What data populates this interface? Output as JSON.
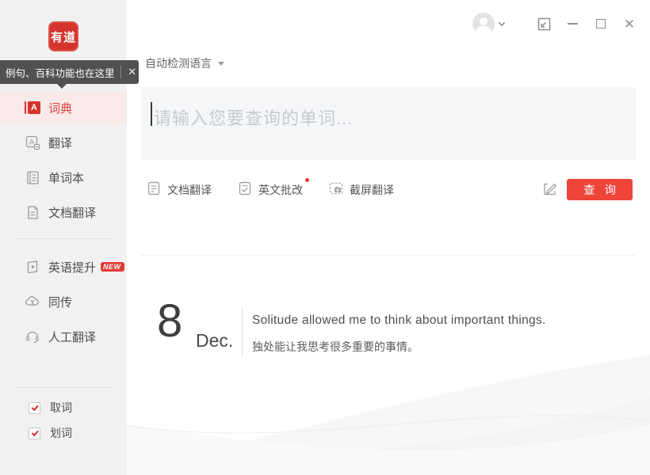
{
  "window": {
    "logo_text": "有道",
    "controls": {
      "close_glyph": "✕"
    }
  },
  "tooltip": {
    "text": "例句、百科功能也在这里",
    "close_glyph": "✕"
  },
  "sidebar": {
    "items": [
      {
        "label": "词典",
        "icon": "dictionary-icon",
        "active": true
      },
      {
        "label": "翻译",
        "icon": "translate-icon"
      },
      {
        "label": "单词本",
        "icon": "wordbook-icon"
      },
      {
        "label": "文档翻译",
        "icon": "document-icon"
      },
      {
        "label": "英语提升",
        "icon": "english-boost-icon",
        "badge": "NEW"
      },
      {
        "label": "同传",
        "icon": "cloud-interpret-icon"
      },
      {
        "label": "人工翻译",
        "icon": "human-translate-icon"
      }
    ],
    "toggles": [
      {
        "label": "取词",
        "checked": true
      },
      {
        "label": "划词",
        "checked": true
      }
    ]
  },
  "topbar": {
    "language_selector": "自动检测语言"
  },
  "search": {
    "placeholder": "请输入您要查询的单词..."
  },
  "shortcuts": [
    {
      "label": "文档翻译",
      "icon": "doc-translate-icon"
    },
    {
      "label": "英文批改",
      "icon": "english-correct-icon",
      "has_red_dot": true
    },
    {
      "label": "截屏翻译",
      "icon": "screenshot-translate-icon"
    }
  ],
  "query_button_label": "查 询",
  "daily_sentence": {
    "day": "8",
    "month": "Dec.",
    "english": "Solitude allowed me to think about important things.",
    "chinese": "独处能让我思考很多重要的事情。"
  },
  "colors": {
    "brand_red": "#d5342c",
    "button_red": "#ee443a",
    "active_item_bg": "#f9e9e8",
    "sidebar_bg": "#f1f1f2",
    "search_box_bg": "#f5f6f8"
  }
}
